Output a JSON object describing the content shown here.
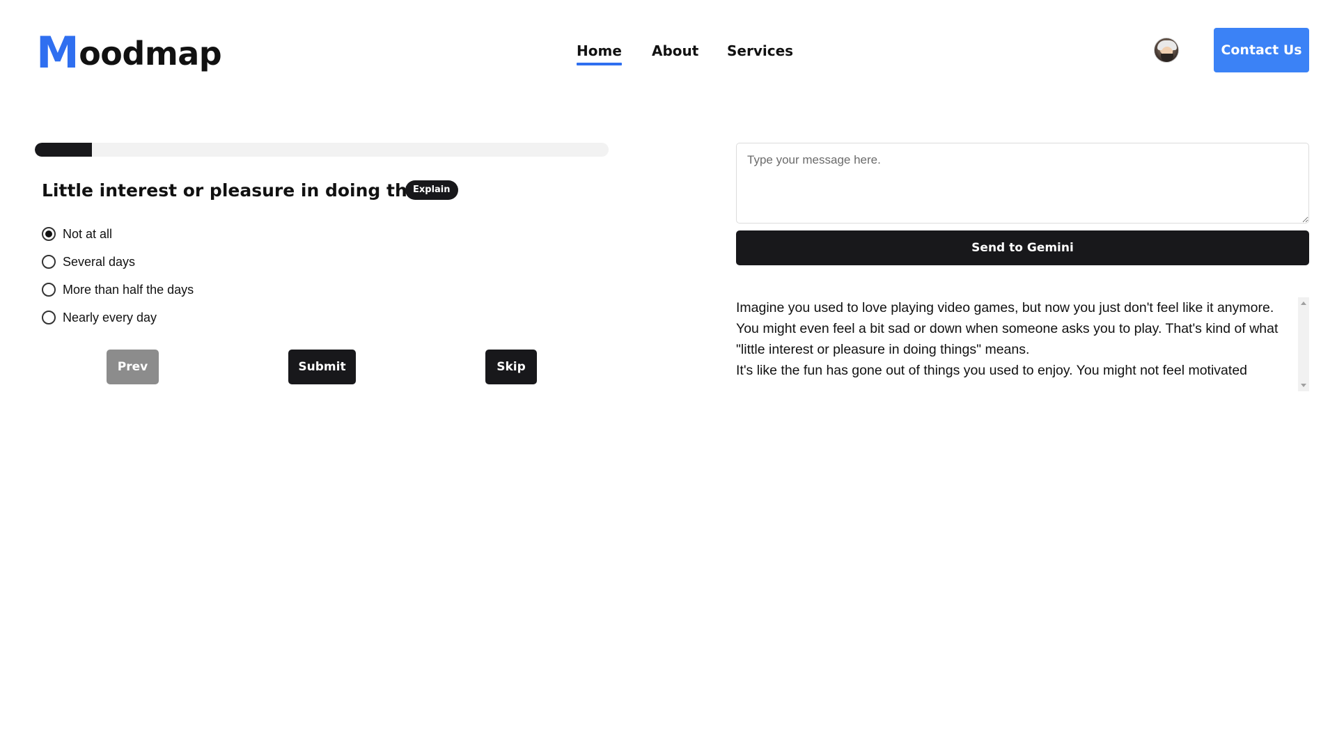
{
  "header": {
    "logo_initial": "M",
    "logo_rest": "oodmap",
    "nav": [
      {
        "label": "Home",
        "active": true
      },
      {
        "label": "About",
        "active": false
      },
      {
        "label": "Services",
        "active": false
      }
    ],
    "contact_label": "Contact Us"
  },
  "questionnaire": {
    "progress": 0.1,
    "question": "Little interest or pleasure in doing things",
    "explain_label": "Explain",
    "options": [
      {
        "label": "Not at all",
        "selected": true
      },
      {
        "label": "Several days",
        "selected": false
      },
      {
        "label": "More than half the days",
        "selected": false
      },
      {
        "label": "Nearly every day",
        "selected": false
      }
    ],
    "prev_label": "Prev",
    "submit_label": "Submit",
    "skip_label": "Skip"
  },
  "chat": {
    "input_value": "",
    "input_placeholder": "Type your message here.",
    "send_label": "Send to Gemini",
    "response_paragraphs": [
      "Imagine you used to love playing video games, but now you just don't feel like it anymore. You might even feel a bit sad or down when someone asks you to play. That's kind of what \"little interest or pleasure in doing things\" means.",
      "It's like the fun has gone out of things you used to enjoy. You might not feel motivated"
    ]
  },
  "colors": {
    "accent": "#3b82f6",
    "dark": "#18181b",
    "disabled": "#8c8c8c"
  }
}
